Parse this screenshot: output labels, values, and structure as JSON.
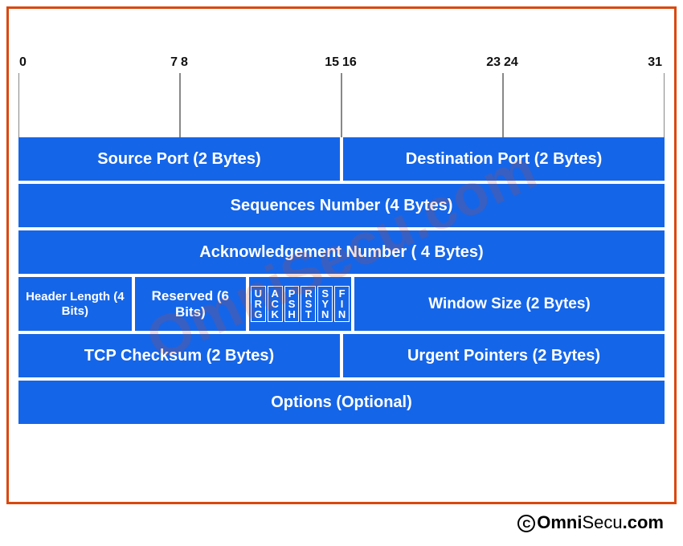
{
  "ruler": {
    "labels": [
      "0",
      "7",
      "8",
      "15",
      "16",
      "23",
      "24",
      "31"
    ]
  },
  "rows": {
    "source_port": "Source Port (2 Bytes)",
    "dest_port": "Destination Port (2 Bytes)",
    "seq_num": "Sequences Number (4 Bytes)",
    "ack_num": "Acknowledgement Number ( 4 Bytes)",
    "hdr_len": "Header Length (4 Bits)",
    "reserved": "Reserved (6 Bits)",
    "flags": [
      [
        "U",
        "R",
        "G"
      ],
      [
        "A",
        "C",
        "K"
      ],
      [
        "P",
        "S",
        "H"
      ],
      [
        "R",
        "S",
        "T"
      ],
      [
        "S",
        "Y",
        "N"
      ],
      [
        "F",
        "I",
        "N"
      ]
    ],
    "window": "Window Size (2 Bytes)",
    "checksum": "TCP Checksum (2 Bytes)",
    "urgent": "Urgent Pointers  (2 Bytes)",
    "options": "Options (Optional)"
  },
  "watermark": "OmniSecu.com",
  "credit": {
    "symbol": "C",
    "brand_first": "Omni",
    "brand_rest": "Secu",
    "domain": ".com"
  }
}
